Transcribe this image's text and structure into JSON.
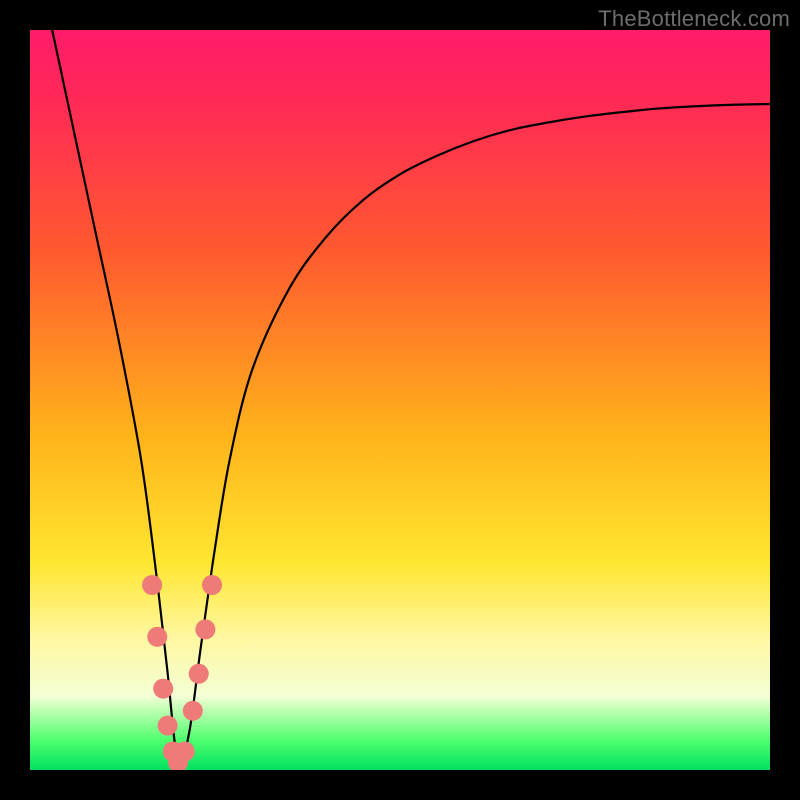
{
  "watermark": "TheBottleneck.com",
  "colors": {
    "frame": "#000000",
    "curve_stroke": "#000000",
    "bead_fill": "#ee7b78",
    "gradient": [
      "#ff1b6b",
      "#ff2a55",
      "#ff5a2f",
      "#ffb41a",
      "#ffe631",
      "#fff7a0",
      "#f3ffd4",
      "#4eff6e",
      "#00e060"
    ]
  },
  "chart_data": {
    "type": "line",
    "title": "",
    "xlabel": "",
    "ylabel": "",
    "xlim": [
      0,
      100
    ],
    "ylim": [
      0,
      100
    ],
    "notes": "V-shaped bottleneck curve; y is mismatch percentage (100 near top-red, 0 at bottom-green). Vertex near x≈20. Background vertical color gradient encodes y from red (high) to green (low).",
    "series": [
      {
        "name": "bottleneck-curve",
        "x": [
          3,
          6,
          9,
          12,
          15,
          17,
          18.5,
          20,
          21.5,
          23,
          25,
          27,
          30,
          35,
          40,
          45,
          50,
          55,
          60,
          65,
          70,
          75,
          80,
          85,
          90,
          95,
          100
        ],
        "values": [
          100,
          86,
          72,
          58,
          42,
          27,
          14,
          1,
          5,
          16,
          30,
          42,
          54,
          65,
          72,
          77,
          80.5,
          83,
          85,
          86.5,
          87.5,
          88.3,
          88.9,
          89.4,
          89.7,
          89.9,
          90
        ]
      }
    ],
    "beads": {
      "name": "data-beads",
      "points": [
        {
          "x": 16.5,
          "y": 25
        },
        {
          "x": 17.2,
          "y": 18
        },
        {
          "x": 18.0,
          "y": 11
        },
        {
          "x": 18.6,
          "y": 6
        },
        {
          "x": 19.3,
          "y": 2.5
        },
        {
          "x": 20.0,
          "y": 1
        },
        {
          "x": 20.9,
          "y": 2.5
        },
        {
          "x": 22.0,
          "y": 8
        },
        {
          "x": 22.8,
          "y": 13
        },
        {
          "x": 23.7,
          "y": 19
        },
        {
          "x": 24.6,
          "y": 25
        }
      ]
    }
  }
}
